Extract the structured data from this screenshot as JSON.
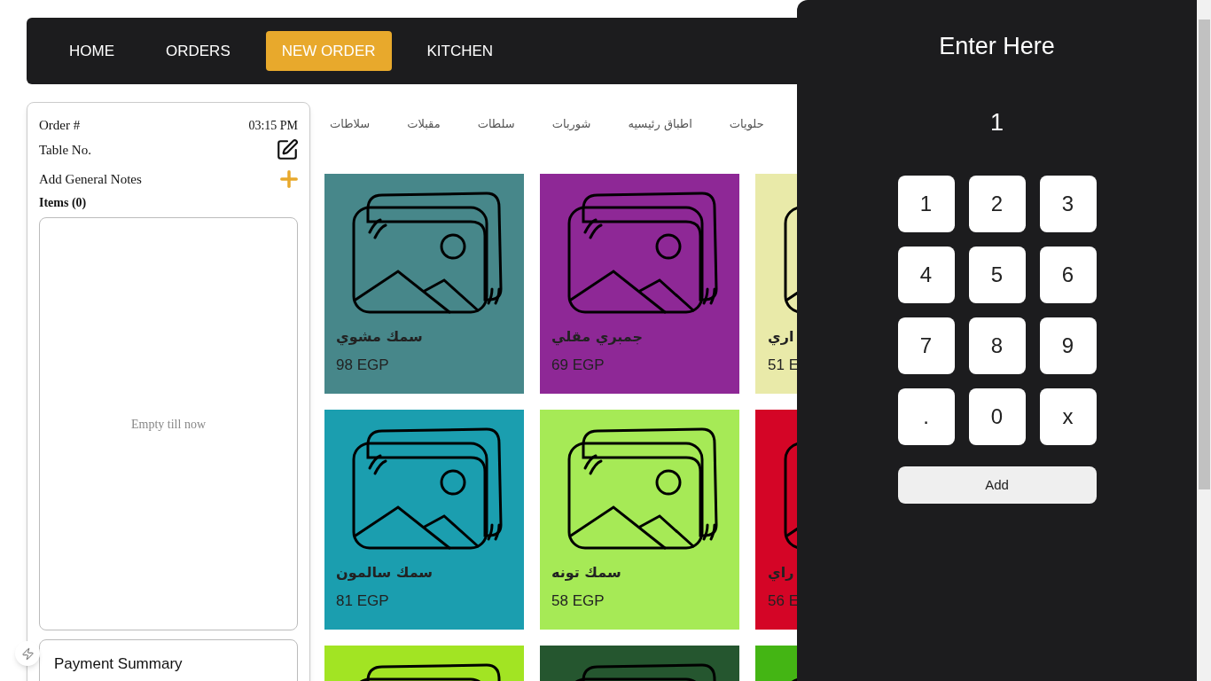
{
  "nav": [
    {
      "label": "KITCHEN",
      "selected": false
    },
    {
      "label": "NEW ORDER",
      "selected": true
    },
    {
      "label": "ORDERS",
      "selected": false
    },
    {
      "label": "HOME",
      "selected": false
    }
  ],
  "order": {
    "order_label": "Order #",
    "time": "03:15 PM",
    "table_label": "Table No.",
    "notes_label": "Add General Notes",
    "items_label": "Items (0)",
    "empty_text": "Empty till now",
    "payment_title": "Payment Summary"
  },
  "categories": [
    {
      "label": "حلويات"
    },
    {
      "label": "اطباق رئيسيه"
    },
    {
      "label": "شوربات"
    },
    {
      "label": "سلطات"
    },
    {
      "label": "مقبلات"
    },
    {
      "label": "سلاطات"
    }
  ],
  "products": [
    {
      "name": "اري",
      "price": "51 E",
      "color": "#e9eaa9"
    },
    {
      "name": "جمبري مقلي",
      "price": "69 EGP",
      "color": "#8e2896"
    },
    {
      "name": "سمك مشوي",
      "price": "98 EGP",
      "color": "#47878a"
    },
    {
      "name": "راي",
      "price": "56 E",
      "color": "#d40526"
    },
    {
      "name": "سمك تونه",
      "price": "58 EGP",
      "color": "#a6ea56"
    },
    {
      "name": "سمك سالمون",
      "price": "81 EGP",
      "color": "#1b9eaf"
    },
    {
      "color": "#44b514"
    },
    {
      "color": "#25562f"
    },
    {
      "color": "#a2e423"
    }
  ],
  "keypad": {
    "title": "Enter Here",
    "display": "1",
    "keys": [
      "3",
      "2",
      "1",
      "6",
      "5",
      "4",
      "9",
      "8",
      "7",
      "x",
      "0",
      "."
    ],
    "add_label": "Add"
  }
}
